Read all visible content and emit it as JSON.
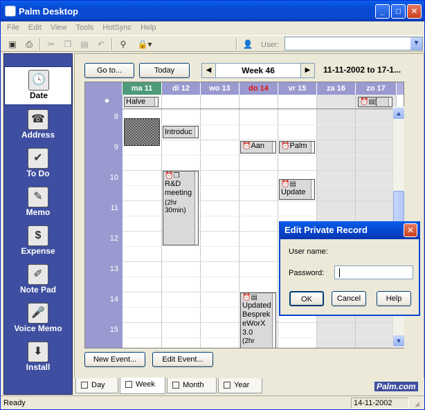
{
  "window": {
    "title": "Palm Desktop"
  },
  "menu": [
    "File",
    "Edit",
    "View",
    "Tools",
    "HotSync",
    "Help"
  ],
  "toolbar": {
    "user_label": "User:",
    "user_value": ""
  },
  "sidebar": {
    "items": [
      {
        "label": "Date",
        "icon": "clock-calendar-icon"
      },
      {
        "label": "Address",
        "icon": "address-card-icon"
      },
      {
        "label": "To Do",
        "icon": "checklist-icon"
      },
      {
        "label": "Memo",
        "icon": "memo-pad-icon"
      },
      {
        "label": "Expense",
        "icon": "money-icon"
      },
      {
        "label": "Note Pad",
        "icon": "note-pad-icon"
      },
      {
        "label": "Voice Memo",
        "icon": "microphone-icon"
      },
      {
        "label": "Install",
        "icon": "install-icon"
      }
    ]
  },
  "nav": {
    "goto_label": "Go to...",
    "today_label": "Today",
    "week_label": "Week 46",
    "range_label": "11-11-2002 to 17-1..."
  },
  "calendar": {
    "days": [
      {
        "label": "ma 11",
        "today": true
      },
      {
        "label": "di 12"
      },
      {
        "label": "wo 13"
      },
      {
        "label": "do 14",
        "highlight": true
      },
      {
        "label": "vr 15"
      },
      {
        "label": "za 16",
        "weekend": true
      },
      {
        "label": "zo 17",
        "weekend": true
      }
    ],
    "hours": [
      "8",
      "9",
      "10",
      "11",
      "12",
      "13",
      "14",
      "15"
    ],
    "events": {
      "allday_mon": "Halve",
      "allday_sun": "[",
      "tue_intro": "Introduc",
      "thu_aan": "Aan",
      "fri_palm": "Palm",
      "fri_update": "Update",
      "tue_rd_title": "R&D meeting",
      "tue_rd_dur": "(2hr 30min)",
      "thu_update": "Updated Besprek eWorX 3.0",
      "thu_update_dur": "(2hr"
    }
  },
  "buttons": {
    "new_event": "New Event...",
    "edit_event": "Edit Event..."
  },
  "tabs": [
    "Day",
    "Week",
    "Month",
    "Year"
  ],
  "brand": "Palm.com",
  "status": {
    "text": "Ready",
    "date": "14-11-2002"
  },
  "dialog": {
    "title": "Edit Private Record",
    "username_label": "User name:",
    "password_label": "Password:",
    "password_value": "",
    "ok": "OK",
    "cancel": "Cancel",
    "help": "Help"
  },
  "colors": {
    "sidebar": "#3e4ea0",
    "today_header": "#4f9a79",
    "day_header": "#9a9ad0",
    "title_blue": "#0a4bd0"
  }
}
